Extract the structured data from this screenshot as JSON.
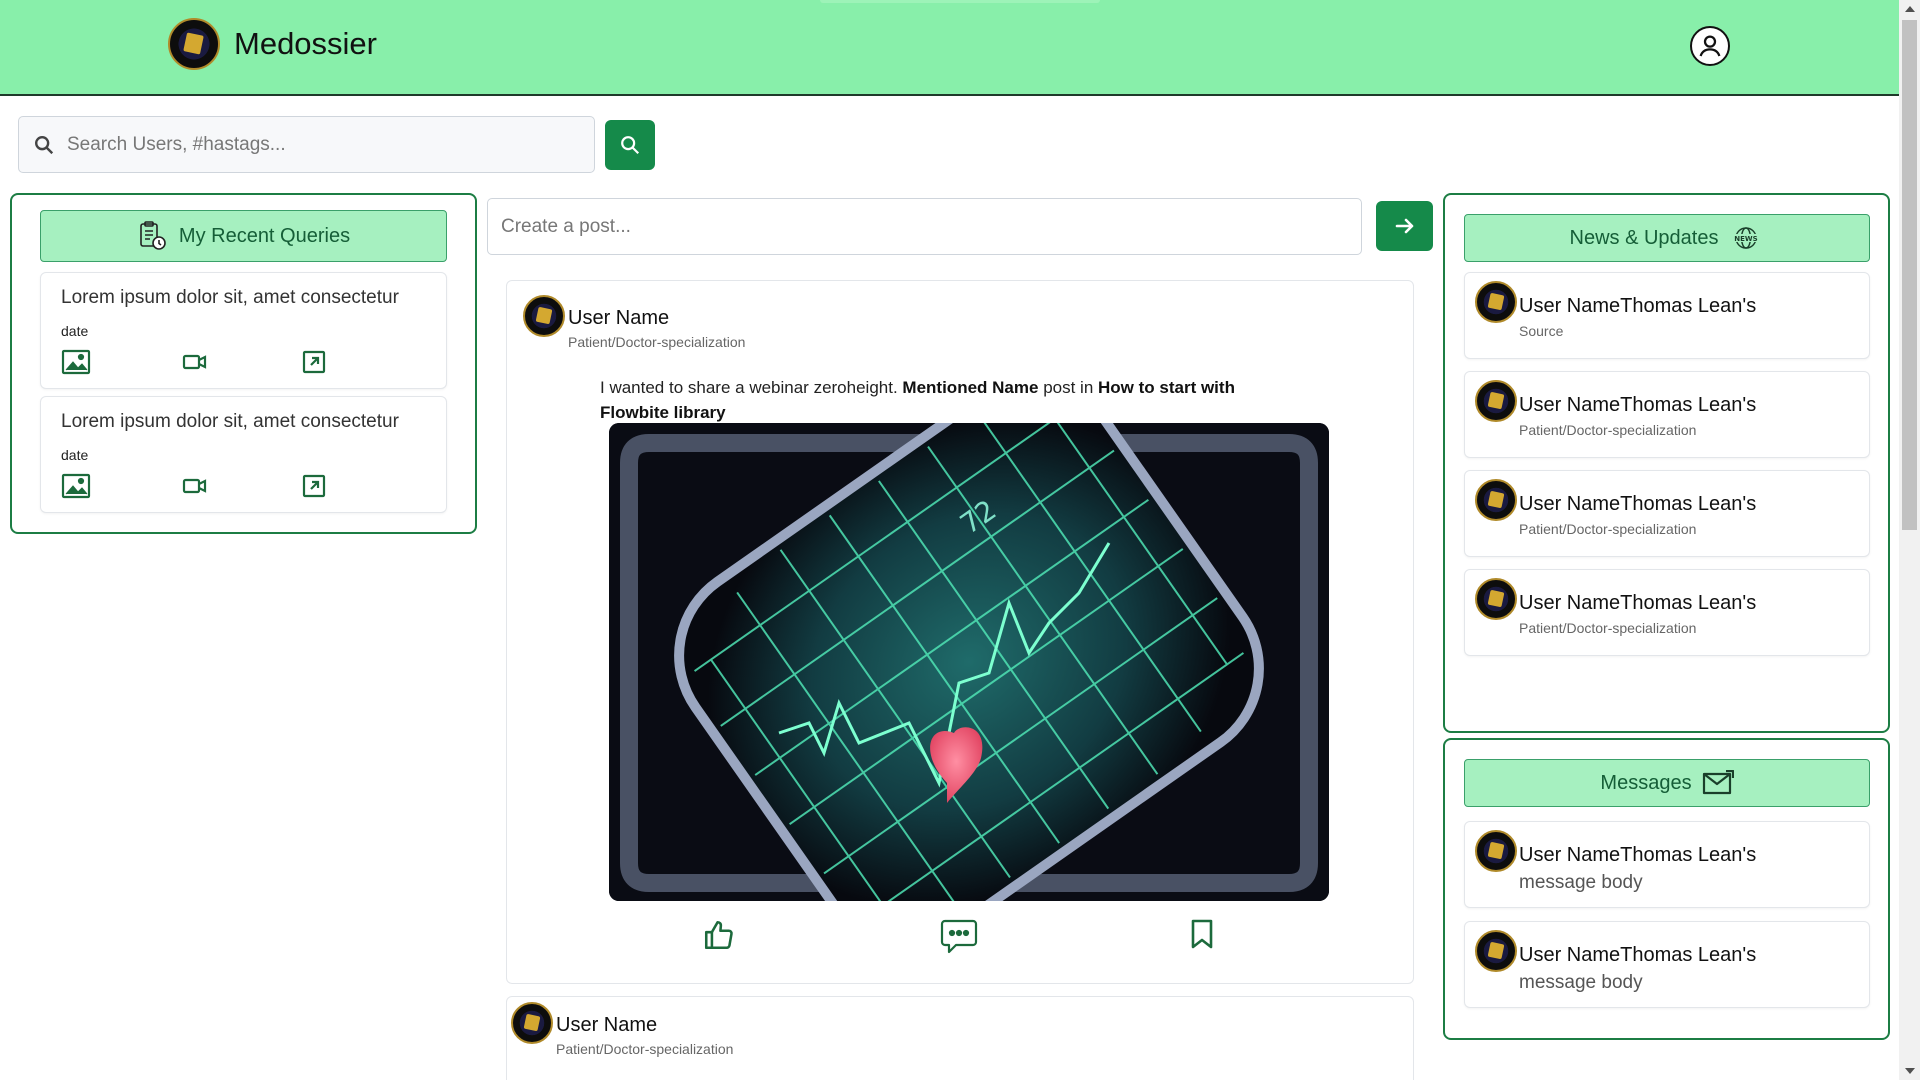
{
  "app": {
    "title": "Medossier"
  },
  "header": {
    "account_icon": "user-circle-icon"
  },
  "search": {
    "placeholder": "Search Users, #hastags...",
    "button_icon": "search-icon"
  },
  "recent_queries": {
    "title": "My Recent Queries",
    "title_icon": "clipboard-clock-icon",
    "items": [
      {
        "text": "Lorem ipsum dolor sit, amet consectetur",
        "date": "date"
      },
      {
        "text": "Lorem ipsum dolor sit, amet consectetur",
        "date": "date"
      }
    ],
    "item_icons": [
      "image-icon",
      "video-icon",
      "external-link-icon"
    ]
  },
  "composer": {
    "placeholder": "Create a post...",
    "button_icon": "arrow-right-icon"
  },
  "posts": [
    {
      "user": "User Name",
      "role": "Patient/Doctor-specialization",
      "text_intro": "I wanted to share a webinar zeroheight.",
      "mention": "Mentioned Name",
      "text_mid": "post in",
      "link": "How to start with Flowbite library",
      "image": "heart-monitor-grid-image",
      "actions": [
        "thumbs-up-icon",
        "comment-icon",
        "bookmark-icon"
      ]
    },
    {
      "user": "User Name",
      "role": "Patient/Doctor-specialization"
    }
  ],
  "news": {
    "title": "News & Updates",
    "title_icon": "news-globe-icon",
    "items": [
      {
        "name": "User NameThomas Lean's",
        "sub": "Source"
      },
      {
        "name": "User NameThomas Lean's",
        "sub": "Patient/Doctor-specialization"
      },
      {
        "name": "User NameThomas Lean's",
        "sub": "Patient/Doctor-specialization"
      },
      {
        "name": "User NameThomas Lean's",
        "sub": "Patient/Doctor-specialization"
      }
    ]
  },
  "messages": {
    "title": "Messages",
    "title_icon": "envelope-icon",
    "items": [
      {
        "name": "User NameThomas Lean's",
        "body": "message body"
      },
      {
        "name": "User NameThomas Lean's",
        "body": "message body"
      }
    ]
  },
  "colors": {
    "header_bg": "#88efaa",
    "accent": "#158a4a",
    "panel_border": "#1c7d44",
    "panel_head_bg": "#a6f0c0"
  }
}
